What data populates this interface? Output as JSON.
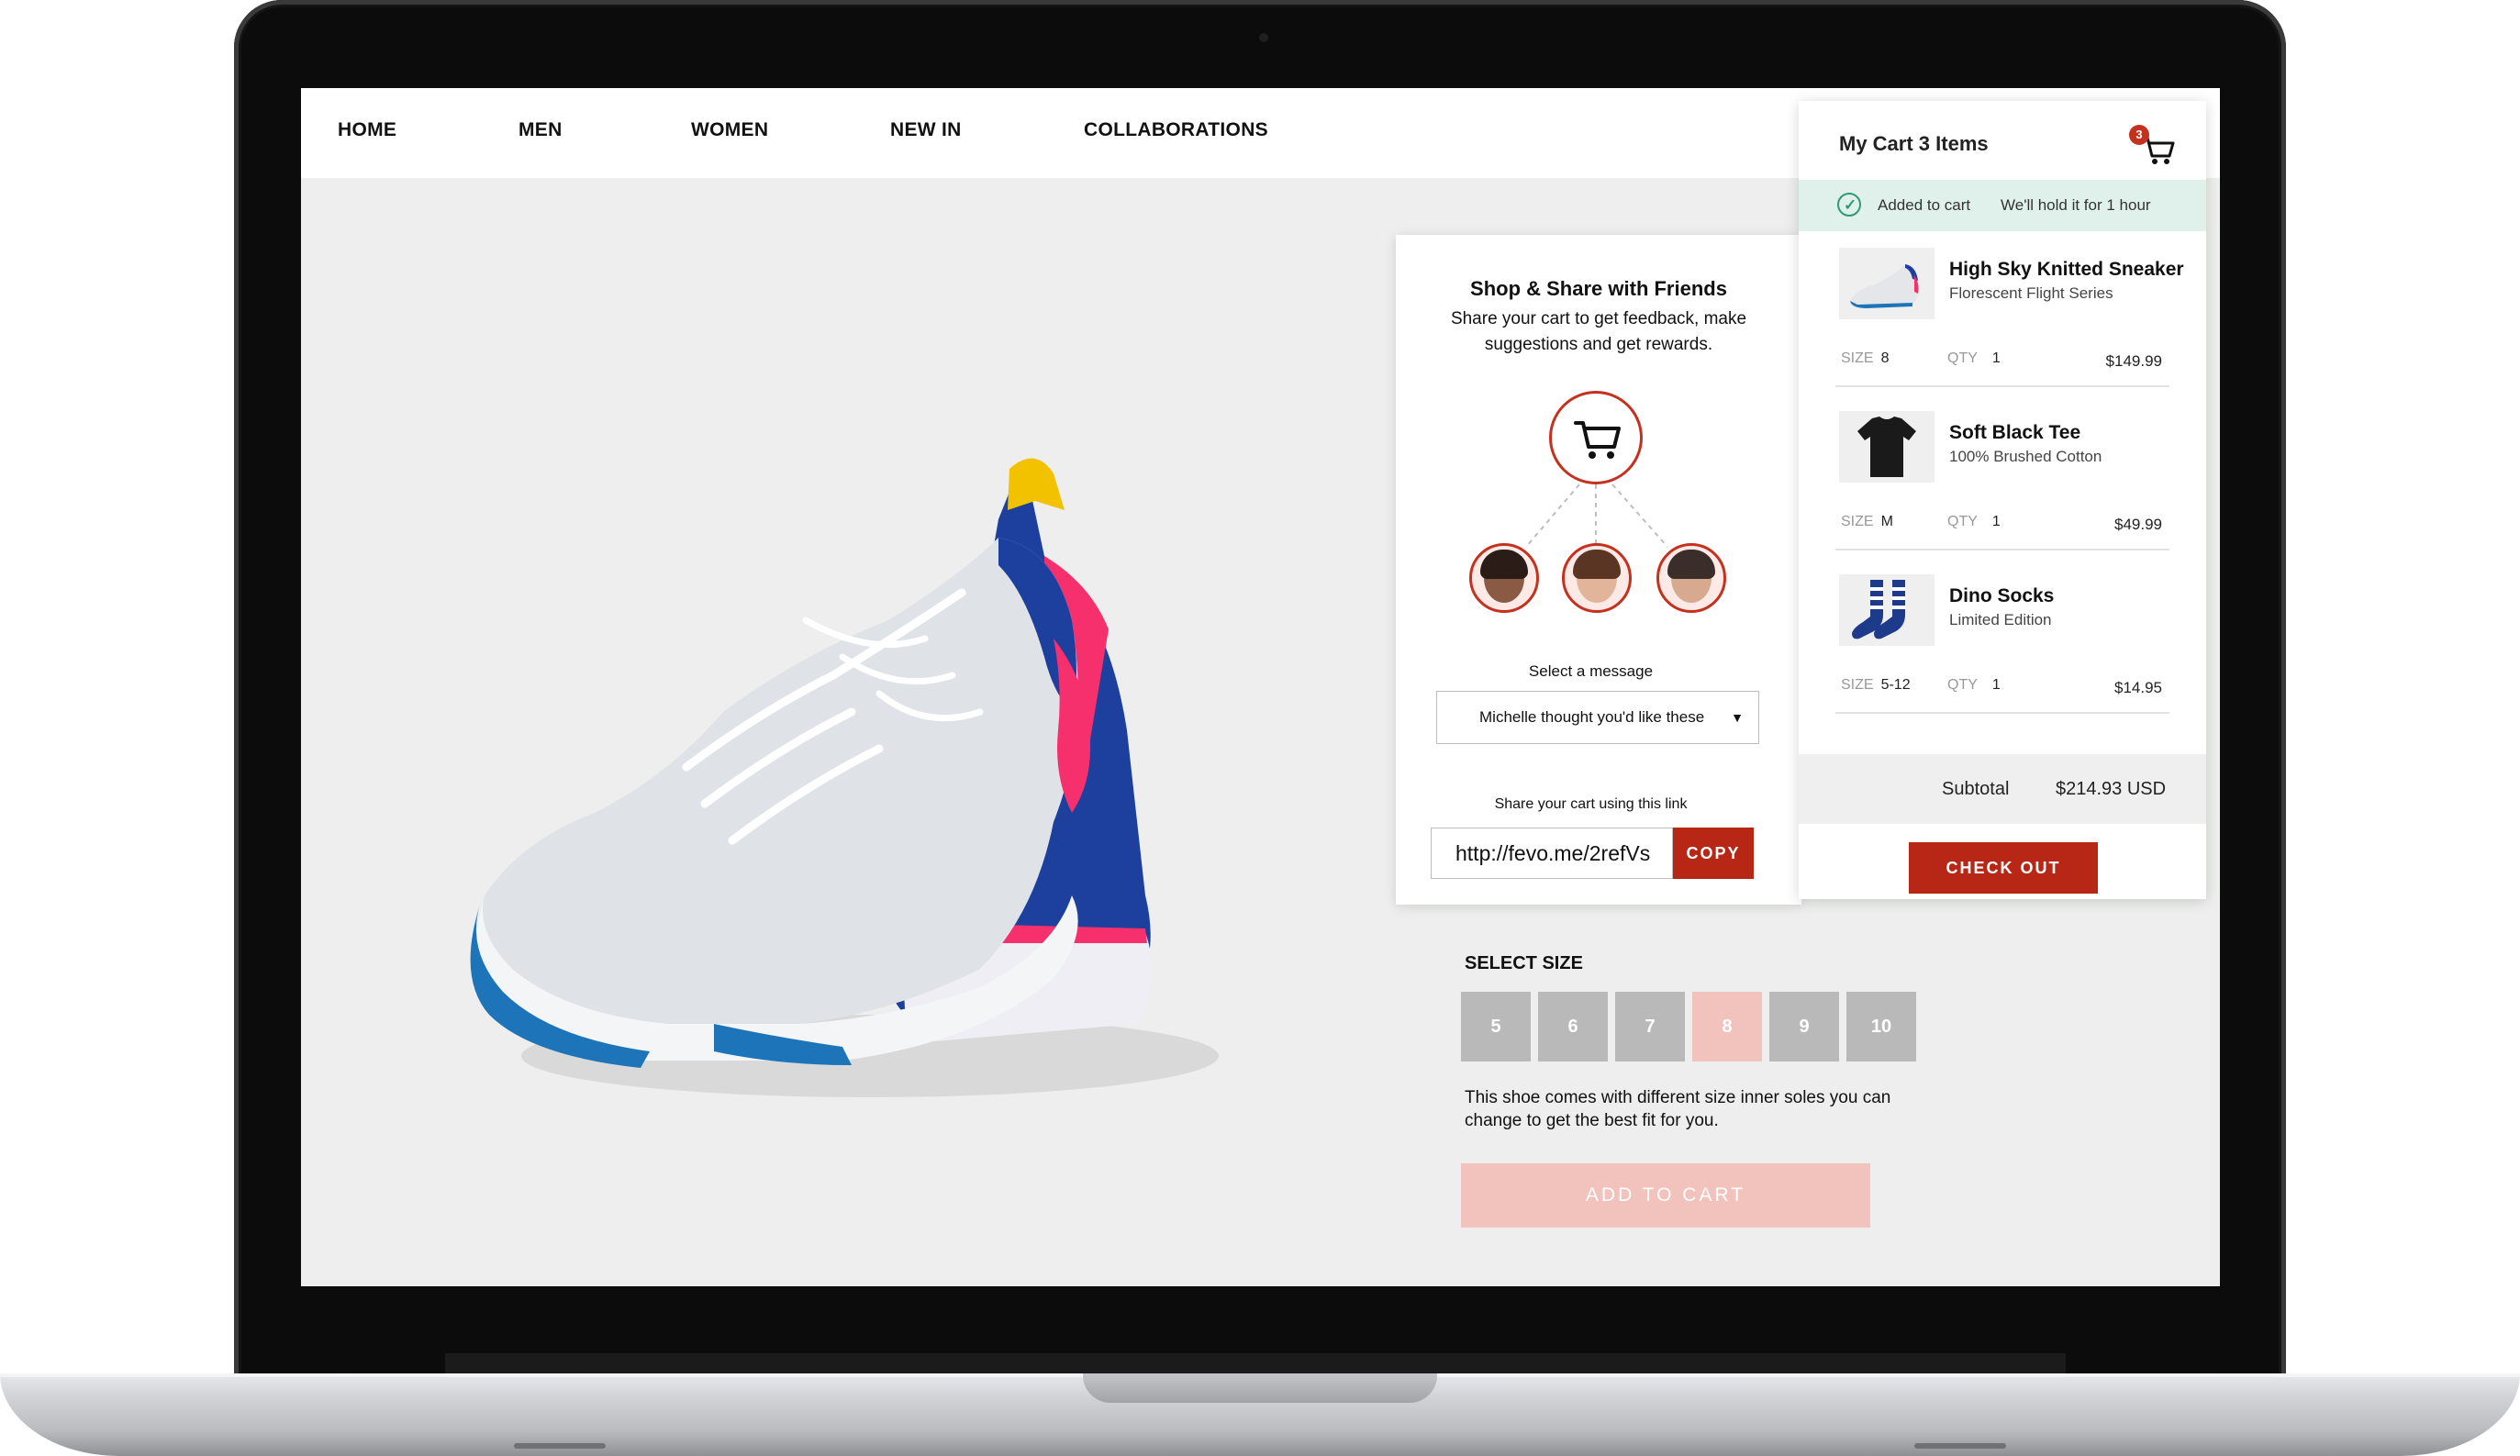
{
  "nav": {
    "items": [
      {
        "label": "HOME"
      },
      {
        "label": "MEN"
      },
      {
        "label": "WOMEN"
      },
      {
        "label": "NEW IN"
      },
      {
        "label": "COLLABORATIONS"
      }
    ]
  },
  "share": {
    "title": "Shop & Share with Friends",
    "description": "Share your cart to get feedback, make suggestions and get rewards.",
    "message_label": "Select a message",
    "message_selected": "Michelle thought you'd like these",
    "link_label": "Share your cart using this link",
    "link_value": "http://fevo.me/2refVs",
    "copy_label": "COPY"
  },
  "cart": {
    "title": "My Cart 3 Items",
    "badge_count": "3",
    "added_text": "Added to cart",
    "hold_text": "We'll hold it for 1 hour",
    "size_label": "SIZE",
    "qty_label": "QTY",
    "items": [
      {
        "name": "High Sky Knitted Sneaker",
        "sub": "Florescent Flight Series",
        "size": "8",
        "qty": "1",
        "price": "$149.99"
      },
      {
        "name": "Soft Black Tee",
        "sub": "100% Brushed Cotton",
        "size": "M",
        "qty": "1",
        "price": "$49.99"
      },
      {
        "name": "Dino Socks",
        "sub": "Limited Edition",
        "size": "5-12",
        "qty": "1",
        "price": "$14.95"
      }
    ],
    "subtotal_label": "Subtotal",
    "subtotal_value": "$214.93 USD",
    "checkout_label": "CHECK OUT"
  },
  "product": {
    "select_size_label": "SELECT SIZE",
    "sizes": [
      "5",
      "6",
      "7",
      "8",
      "9",
      "10"
    ],
    "selected_size": "8",
    "size_note": "This shoe comes with different size inner soles you can change to get the best fit for you.",
    "add_to_cart_label": "ADD TO CART"
  },
  "colors": {
    "accent": "#b82715",
    "accent_light": "#f2c3bc",
    "success": "#2f9a73",
    "success_bg": "#e0f1ec"
  }
}
